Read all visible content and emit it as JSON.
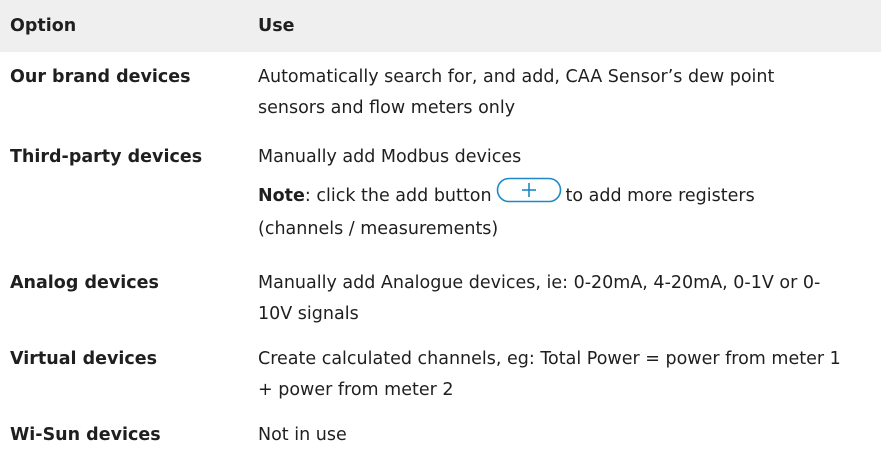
{
  "header": {
    "option": "Option",
    "use": "Use"
  },
  "rows": [
    {
      "option": "Our brand devices",
      "use": "Automatically search for, and add, CAA Sensor’s dew point sensors and flow meters only"
    },
    {
      "option": "Third-party devices",
      "use": "Manually add Modbus devices",
      "note_label": "Note",
      "note_before": ": click the add button",
      "note_after": "to add more registers (channels / measurements)",
      "note_icon": "plus-button-icon"
    },
    {
      "option": "Analog devices",
      "use": "Manually add Analogue devices, ie: 0-20mA, 4-20mA, 0-1V or 0-10V signals"
    },
    {
      "option": "Virtual devices",
      "use": "Create calculated channels, eg: Total Power = power from meter 1 + power from meter 2"
    },
    {
      "option": "Wi-Sun devices",
      "use": "Not in use"
    }
  ],
  "colors": {
    "header_bg": "#efefef",
    "icon_stroke": "#1e88c8"
  }
}
